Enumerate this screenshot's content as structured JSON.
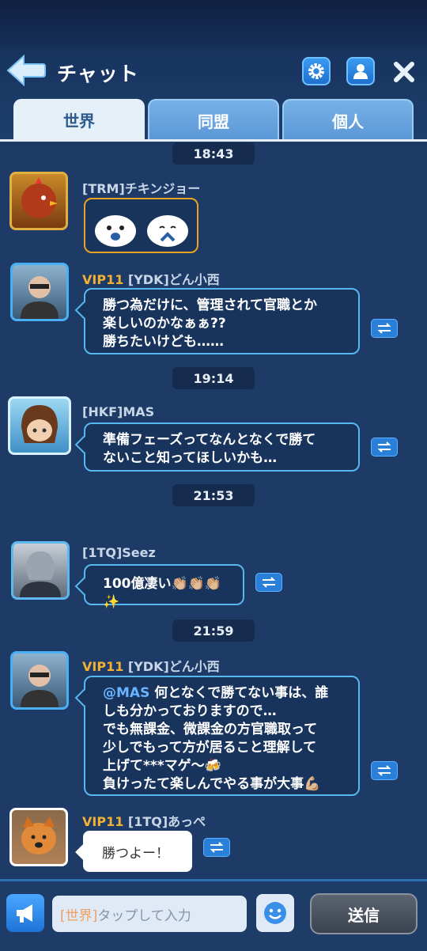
{
  "header": {
    "title": "チャット"
  },
  "tabs": [
    {
      "label": "世界",
      "active": true
    },
    {
      "label": "同盟",
      "active": false
    },
    {
      "label": "個人",
      "active": false
    }
  ],
  "messages": [
    {
      "time": "18:43",
      "name": "[TRM]チキンジョー"
    },
    {
      "vip": "VIP11",
      "name": "[YDK]どん小西",
      "lines": [
        "勝つ為だけに、管理されて官職とか",
        "楽しいのかなぁぁ??",
        "勝ちたいけども……"
      ]
    },
    {
      "time": "19:14",
      "name": "[HKF]MAS",
      "lines": [
        "準備フェーズってなんとなくで勝て",
        "ないこと知ってほしいかも…"
      ]
    },
    {
      "time": "21:53",
      "name": "[1TQ]Seez",
      "text": "100億凄い👏🏼👏🏼👏🏼✨"
    },
    {
      "time": "21:59",
      "vip": "VIP11",
      "name": "[YDK]どん小西",
      "mention": "@MAS",
      "lines": [
        "何となくで勝てない事は、誰",
        "しも分かっておりますので…",
        "でも無課金、微課金の方官職取って",
        "少しでもって方が居ること理解して",
        "上げて***マゲ～🍻",
        "負けったて楽しんでやる事が大事💪🏼"
      ]
    },
    {
      "vip": "VIP11",
      "name": "[1TQ]あっぺ",
      "text": "勝つよー！"
    }
  ],
  "input": {
    "tag": "[世界]",
    "placeholder": "タップして入力"
  },
  "send_label": "送信",
  "colors": {
    "background": "#1d3b66",
    "vip": "#f2b133",
    "bubble_border": "#55b8ee",
    "accent": "#2a7fd8"
  }
}
